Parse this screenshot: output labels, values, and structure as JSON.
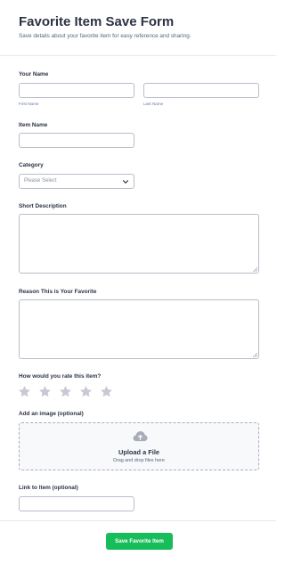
{
  "form": {
    "title": "Favorite Item Save Form",
    "subtitle": "Save details about your favorite item for easy reference and sharing."
  },
  "fields": {
    "your_name": {
      "label": "Your Name",
      "first_sublabel": "First Name",
      "last_sublabel": "Last Name",
      "first_value": "",
      "last_value": ""
    },
    "item_name": {
      "label": "Item Name",
      "value": ""
    },
    "category": {
      "label": "Category",
      "selected": "Please Select"
    },
    "short_description": {
      "label": "Short Description",
      "value": ""
    },
    "reason": {
      "label": "Reason This is Your Favorite",
      "value": ""
    },
    "rating": {
      "label": "How would you rate this item?",
      "max_stars": 5,
      "value": 0
    },
    "image": {
      "label": "Add an image (optional)",
      "upload_title": "Upload a File",
      "upload_hint": "Drag and drop files here"
    },
    "link": {
      "label": "Link to Item (optional)",
      "value": ""
    }
  },
  "submit": {
    "label": "Save Favorite Item"
  },
  "colors": {
    "accent": "#18bd5b",
    "text": "#2c3345",
    "border": "#b8bdc9",
    "star": "#c8cad3"
  },
  "icons": {
    "select_arrow": "chevron-down-icon",
    "upload": "cloud-upload-icon",
    "rating": "star-icon"
  }
}
